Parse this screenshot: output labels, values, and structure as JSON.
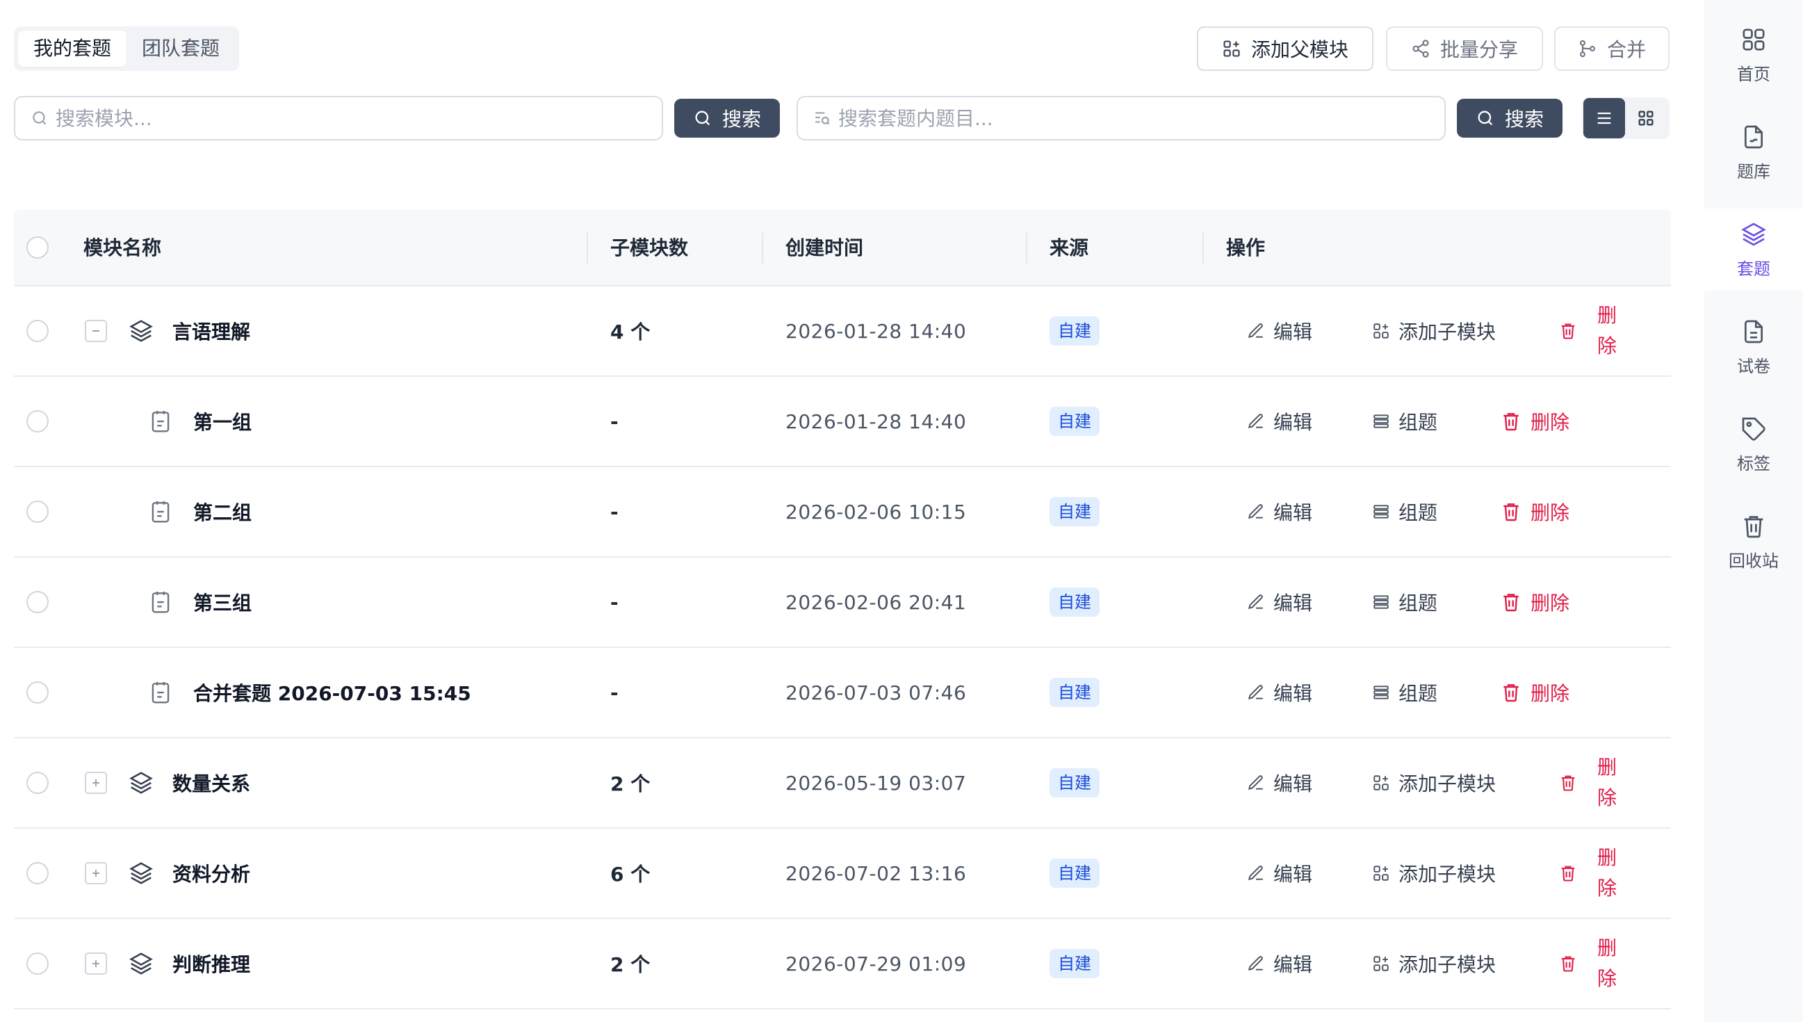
{
  "tabs": [
    {
      "label": "我的套题",
      "active": true
    },
    {
      "label": "团队套题",
      "active": false
    }
  ],
  "toolbar": {
    "add_parent_label": "添加父模块",
    "batch_share_label": "批量分享",
    "merge_label": "合并"
  },
  "search": {
    "module_placeholder": "搜索模块...",
    "module_button": "搜索",
    "question_placeholder": "搜索套题内题目...",
    "question_button": "搜索"
  },
  "table": {
    "headers": {
      "name": "模块名称",
      "children": "子模块数",
      "created": "创建时间",
      "source": "来源",
      "actions": "操作"
    },
    "rows": [
      {
        "name": "言语理解",
        "children": "4 个",
        "created": "2026-01-28 14:40",
        "source": "自建",
        "level": 0,
        "expand": "minus"
      },
      {
        "name": "第一组",
        "children": "-",
        "created": "2026-01-28 14:40",
        "source": "自建",
        "level": 1
      },
      {
        "name": "第二组",
        "children": "-",
        "created": "2026-02-06 10:15",
        "source": "自建",
        "level": 1
      },
      {
        "name": "第三组",
        "children": "-",
        "created": "2026-02-06 20:41",
        "source": "自建",
        "level": 1
      },
      {
        "name": "合并套题 2026-07-03 15:45",
        "children": "-",
        "created": "2026-07-03 07:46",
        "source": "自建",
        "level": 1
      },
      {
        "name": "数量关系",
        "children": "2 个",
        "created": "2026-05-19 03:07",
        "source": "自建",
        "level": 0,
        "expand": "plus"
      },
      {
        "name": "资料分析",
        "children": "6 个",
        "created": "2026-07-02 13:16",
        "source": "自建",
        "level": 0,
        "expand": "plus"
      },
      {
        "name": "判断推理",
        "children": "2 个",
        "created": "2026-07-29 01:09",
        "source": "自建",
        "level": 0,
        "expand": "plus"
      }
    ],
    "actions": {
      "edit": "编辑",
      "add_child": "添加子模块",
      "questions": "组题",
      "delete": "删除"
    }
  },
  "sidebar": {
    "items": [
      {
        "label": "首页",
        "icon": "grid-icon"
      },
      {
        "label": "题库",
        "icon": "file-icon"
      },
      {
        "label": "套题",
        "icon": "layers-icon",
        "active": true
      },
      {
        "label": "试卷",
        "icon": "document-icon"
      },
      {
        "label": "标签",
        "icon": "tag-icon"
      },
      {
        "label": "回收站",
        "icon": "trash-icon"
      }
    ]
  },
  "colors": {
    "primary_dark": "#3f4b60",
    "accent_purple": "#6d4de6",
    "danger": "#e11d48",
    "badge_bg": "#e0eefe",
    "badge_text": "#1d4ed8"
  }
}
